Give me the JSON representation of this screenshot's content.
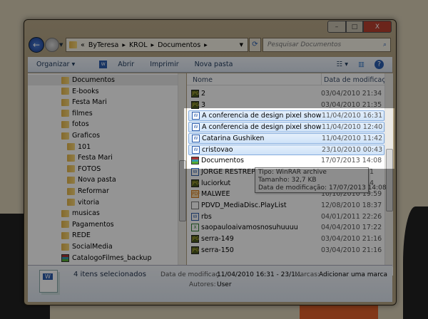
{
  "window": {
    "buttons": {
      "minimize": "–",
      "maximize": "□",
      "close": "X"
    }
  },
  "address": {
    "prefix": "«",
    "crumbs": [
      "ByTeresa",
      "KROL",
      "Documentos"
    ],
    "search_placeholder": "Pesquisar Documentos"
  },
  "toolbar": {
    "organize": "Organizar ▾",
    "open": "Abrir",
    "print": "Imprimir",
    "new_folder": "Nova pasta"
  },
  "tree": [
    {
      "label": "Documentos",
      "level": 0,
      "icon": "folder"
    },
    {
      "label": "E-books",
      "level": 0,
      "icon": "folder"
    },
    {
      "label": "Festa Mari",
      "level": 0,
      "icon": "folder"
    },
    {
      "label": "filmes",
      "level": 0,
      "icon": "folder"
    },
    {
      "label": "fotos",
      "level": 0,
      "icon": "folder"
    },
    {
      "label": "Graficos",
      "level": 0,
      "icon": "folder"
    },
    {
      "label": "101",
      "level": 1,
      "icon": "folder"
    },
    {
      "label": "Festa Mari",
      "level": 1,
      "icon": "folder"
    },
    {
      "label": "FOTOS",
      "level": 1,
      "icon": "folder"
    },
    {
      "label": "Nova pasta",
      "level": 1,
      "icon": "folder"
    },
    {
      "label": "Reformar",
      "level": 1,
      "icon": "folder"
    },
    {
      "label": "vitoria",
      "level": 1,
      "icon": "folder"
    },
    {
      "label": "musicas",
      "level": 0,
      "icon": "folder"
    },
    {
      "label": "Pagamentos",
      "level": 0,
      "icon": "folder"
    },
    {
      "label": "REDE",
      "level": 0,
      "icon": "folder"
    },
    {
      "label": "SocialMedia",
      "level": 0,
      "icon": "folder"
    },
    {
      "label": "CatalogoFilmes_backup",
      "level": 0,
      "icon": "rar"
    }
  ],
  "columns": {
    "name": "Nome",
    "date": "Data de modificaç..."
  },
  "files": [
    {
      "name": "2",
      "date": "03/04/2010 21:34",
      "type": "jpg",
      "selected": false
    },
    {
      "name": "3",
      "date": "03/04/2010 21:35",
      "type": "jpg",
      "selected": false
    },
    {
      "name": "A conferencia de design pixel show acon...",
      "date": "11/04/2010 16:31",
      "type": "word",
      "selected": true
    },
    {
      "name": "A conferencia de design pixel show acon...",
      "date": "11/04/2010 12:40",
      "type": "word",
      "selected": true
    },
    {
      "name": "Catarina Gushiken",
      "date": "11/04/2010 11:42",
      "type": "word",
      "selected": true
    },
    {
      "name": "cristovao",
      "date": "23/10/2010 00:43",
      "type": "word",
      "selected": true
    },
    {
      "name": "Documentos",
      "date": "17/07/2013 14:08",
      "type": "rar",
      "selected": false
    },
    {
      "name": "JORGE RESTREPO",
      "date": "1",
      "type": "word",
      "selected": false
    },
    {
      "name": "luciorkut",
      "date": "4",
      "type": "jpg",
      "selected": false
    },
    {
      "name": "MALWEE",
      "date": "10/10/2010 19:59",
      "type": "pdf",
      "selected": false
    },
    {
      "name": "PDVD_MediaDisc.PlayList",
      "date": "12/08/2010 18:37",
      "type": "blank",
      "selected": false
    },
    {
      "name": "rbs",
      "date": "04/01/2011 22:26",
      "type": "word",
      "selected": false
    },
    {
      "name": "saopauloaivamosnosuhuuuu",
      "date": "04/04/2010 17:22",
      "type": "xls",
      "selected": false
    },
    {
      "name": "serra-149",
      "date": "03/04/2010 21:16",
      "type": "jpg",
      "selected": false
    },
    {
      "name": "serra-150",
      "date": "03/04/2010 21:16",
      "type": "jpg",
      "selected": false
    }
  ],
  "tooltip": {
    "type": "Tipo: WinRAR archive",
    "size": "Tamanho: 32,7 KB",
    "modified": "Data de modificação: 17/07/2013 14:08"
  },
  "details": {
    "count": "4 itens selecionados",
    "date_label": "Data de modificaç...",
    "date_value": "11/04/2010 16:31 - 23/1...",
    "tags_label": "Marcas:",
    "tags_value": "Adicionar uma marca",
    "authors_label": "Autores:",
    "authors_value": "User"
  }
}
